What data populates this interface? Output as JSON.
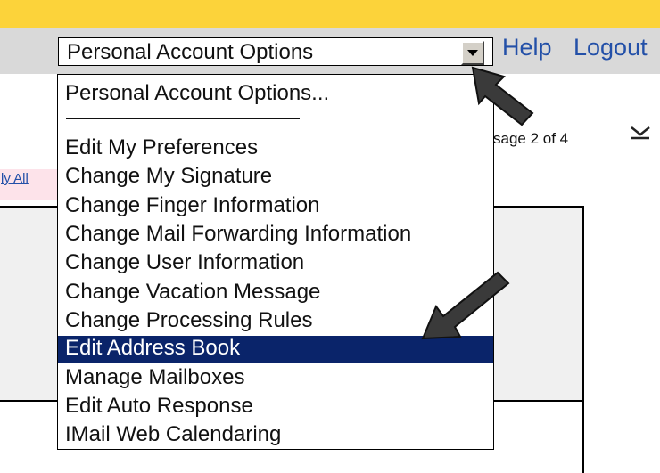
{
  "header": {
    "help_label": "Help",
    "logout_label": "Logout"
  },
  "account_select": {
    "selected_value": "Personal Account Options"
  },
  "dropdown": {
    "items": [
      {
        "label": "Personal Account Options...",
        "selected": false
      },
      {
        "label": "Edit My Preferences",
        "selected": false
      },
      {
        "label": "Change My Signature",
        "selected": false
      },
      {
        "label": "Change Finger Information",
        "selected": false
      },
      {
        "label": "Change Mail Forwarding Information",
        "selected": false
      },
      {
        "label": "Change User Information",
        "selected": false
      },
      {
        "label": "Change Vacation Message",
        "selected": false
      },
      {
        "label": "Change Processing Rules",
        "selected": false
      },
      {
        "label": "Edit Address Book",
        "selected": true
      },
      {
        "label": "Manage Mailboxes",
        "selected": false
      },
      {
        "label": "Edit Auto Response",
        "selected": false
      },
      {
        "label": "IMail Web Calendaring",
        "selected": false
      }
    ]
  },
  "message_nav": {
    "page_text": "sage 2 of 4",
    "reply_all_text": "ly All"
  },
  "colors": {
    "top_bar": "#fcd33a",
    "toolbar": "#d9d9d9",
    "link": "#2350a8",
    "selection": "#0a246a",
    "annotation_arrow": "#3a3a3a"
  },
  "icons": {
    "dropdown_toggle": "triangle-down-icon",
    "next_message": "chevron-down-icon",
    "annotation": "arrow-icon"
  }
}
